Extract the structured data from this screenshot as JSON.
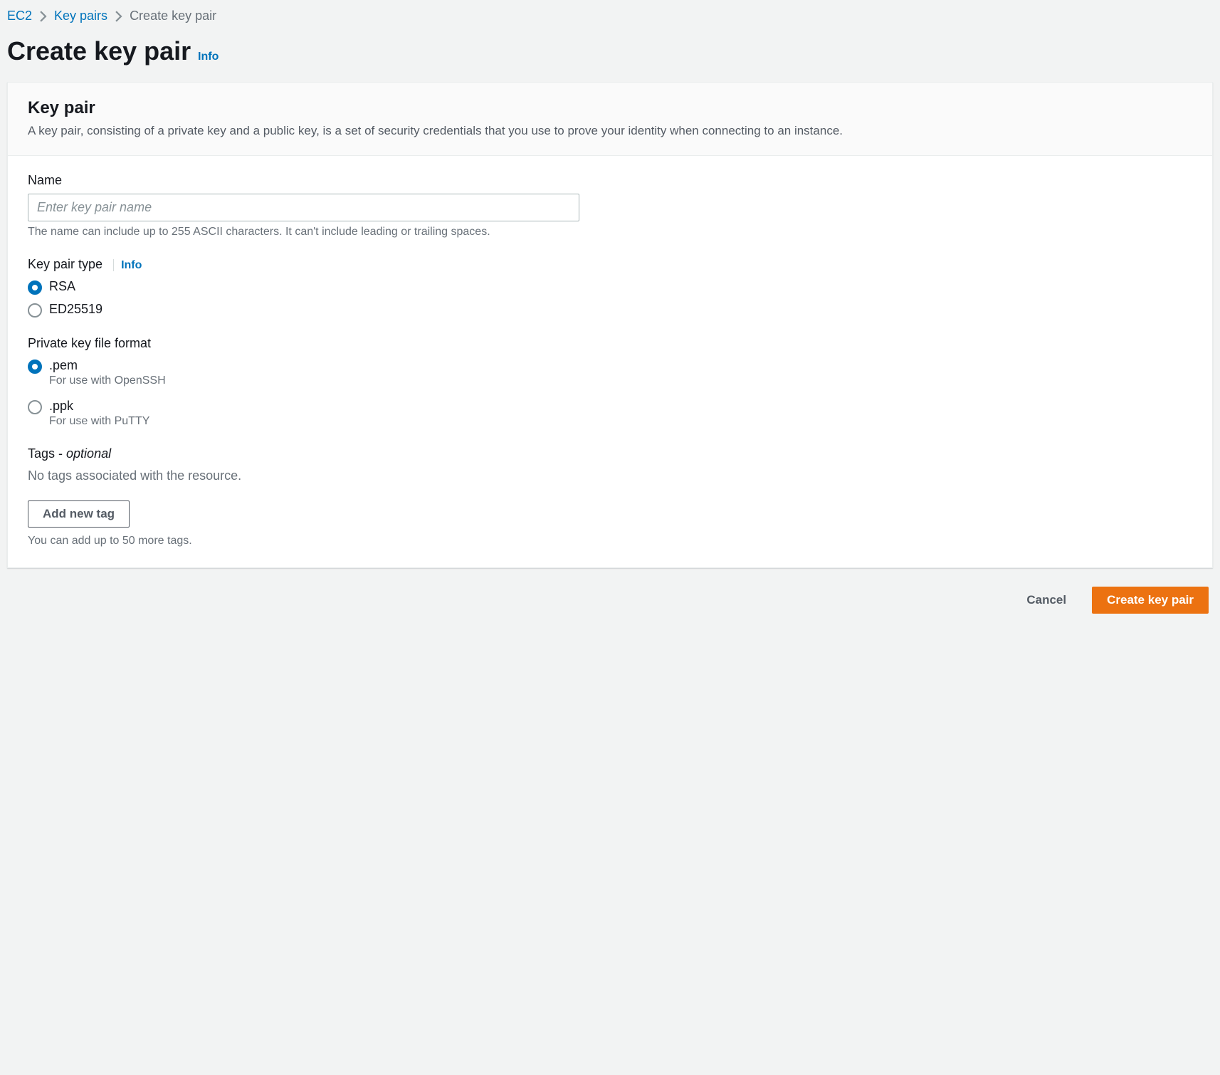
{
  "breadcrumb": {
    "items": [
      "EC2",
      "Key pairs"
    ],
    "current": "Create key pair"
  },
  "page": {
    "title": "Create key pair",
    "info": "Info"
  },
  "panel": {
    "title": "Key pair",
    "description": "A key pair, consisting of a private key and a public key, is a set of security credentials that you use to prove your identity when connecting to an instance."
  },
  "name": {
    "label": "Name",
    "placeholder": "Enter key pair name",
    "value": "",
    "helper": "The name can include up to 255 ASCII characters. It can't include leading or trailing spaces."
  },
  "keypair_type": {
    "label": "Key pair type",
    "info": "Info",
    "options": [
      {
        "label": "RSA",
        "checked": true
      },
      {
        "label": "ED25519",
        "checked": false
      }
    ]
  },
  "format": {
    "label": "Private key file format",
    "options": [
      {
        "label": ".pem",
        "sub": "For use with OpenSSH",
        "checked": true
      },
      {
        "label": ".ppk",
        "sub": "For use with PuTTY",
        "checked": false
      }
    ]
  },
  "tags": {
    "label": "Tags - ",
    "optional": "optional",
    "empty": "No tags associated with the resource.",
    "add_button": "Add new tag",
    "limit": "You can add up to 50 more tags."
  },
  "footer": {
    "cancel": "Cancel",
    "submit": "Create key pair"
  }
}
